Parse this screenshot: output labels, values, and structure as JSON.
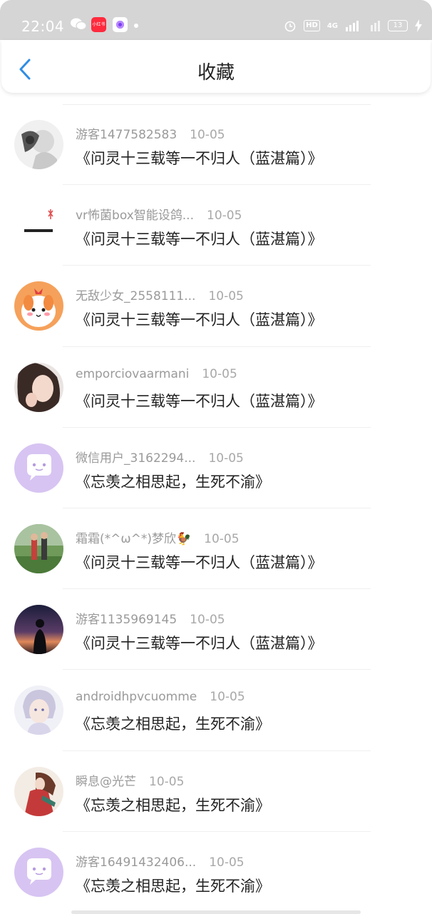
{
  "status_bar": {
    "time": "22:04",
    "battery": "13",
    "hd": "HD",
    "network": "4G"
  },
  "header": {
    "title": "收藏"
  },
  "items": [
    {
      "username": "游客1477582583",
      "date": "10-05",
      "content": "《问灵十三载等一不归人（蓝湛篇）》",
      "avatar": "sketch-photo"
    },
    {
      "username": "vr怖菌box智能设鸽...",
      "date": "10-05",
      "content": "《问灵十三载等一不归人（蓝湛篇）》",
      "avatar": "dragonfly-text"
    },
    {
      "username": "无敌少女_2558111...",
      "date": "10-05",
      "content": "《问灵十三载等一不归人（蓝湛篇）》",
      "avatar": "cartoon-dog"
    },
    {
      "username": "emporciovaarmani",
      "date": "10-05",
      "content": "《问灵十三载等一不归人（蓝湛篇）》",
      "avatar": "girl-photo"
    },
    {
      "username": "微信用户_3162294...",
      "date": "10-05",
      "content": "《忘羡之相思起，生死不渝》",
      "avatar": "default-chat"
    },
    {
      "username": "霜霜(*^ω^*)梦欣🐓",
      "date": "10-05",
      "content": "《问灵十三载等一不归人（蓝湛篇）》",
      "avatar": "outdoor-photo"
    },
    {
      "username": "游客1135969145",
      "date": "10-05",
      "content": "《问灵十三载等一不归人（蓝湛篇）》",
      "avatar": "sunset-silhouette"
    },
    {
      "username": "androidhpvcuomme",
      "date": "10-05",
      "content": "《忘羡之相思起，生死不渝》",
      "avatar": "anime-boy"
    },
    {
      "username": "瞬息@光芒",
      "date": "10-05",
      "content": "《忘羡之相思起，生死不渝》",
      "avatar": "ancient-girl"
    },
    {
      "username": "游客16491432406...",
      "date": "10-05",
      "content": "《忘羡之相思起，生死不渝》",
      "avatar": "default-chat"
    }
  ],
  "colors": {
    "accent": "#2f8de4",
    "default_avatar": "#d7c4f2"
  }
}
